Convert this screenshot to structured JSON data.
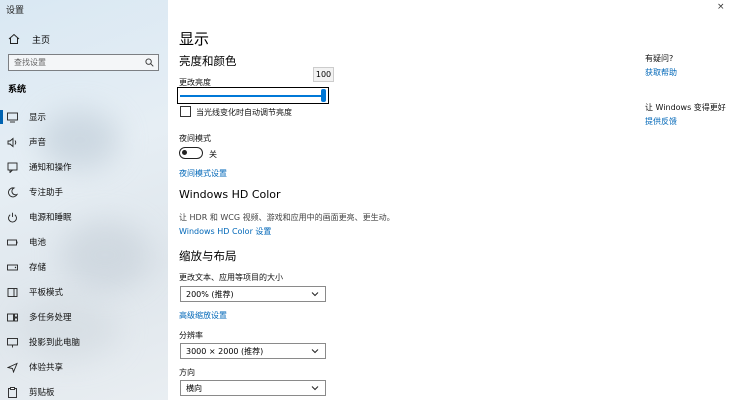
{
  "window": {
    "title": "设置",
    "close_glyph": "×"
  },
  "sidebar": {
    "home_label": "主页",
    "search_placeholder": "查找设置",
    "section": "系统",
    "items": [
      {
        "label": "显示",
        "icon": "monitor-icon"
      },
      {
        "label": "声音",
        "icon": "speaker-icon"
      },
      {
        "label": "通知和操作",
        "icon": "notification-icon"
      },
      {
        "label": "专注助手",
        "icon": "moon-icon"
      },
      {
        "label": "电源和睡眠",
        "icon": "power-icon"
      },
      {
        "label": "电池",
        "icon": "battery-icon"
      },
      {
        "label": "存储",
        "icon": "storage-icon"
      },
      {
        "label": "平板模式",
        "icon": "tablet-icon"
      },
      {
        "label": "多任务处理",
        "icon": "multitask-icon"
      },
      {
        "label": "投影到此电脑",
        "icon": "projector-icon"
      },
      {
        "label": "体验共享",
        "icon": "share-icon"
      },
      {
        "label": "剪贴板",
        "icon": "clipboard-icon"
      }
    ]
  },
  "main": {
    "title": "显示",
    "brightness": {
      "heading": "亮度和颜色",
      "label": "更改亮度",
      "value": 100,
      "tooltip": "100",
      "auto_checkbox_label": "当光线变化时自动调节亮度",
      "auto_checked": false
    },
    "night_light": {
      "label": "夜间模式",
      "toggle_state": "关",
      "toggle_on": false,
      "settings_link": "夜间模式设置"
    },
    "hdr": {
      "heading": "Windows HD Color",
      "description": "让 HDR 和 WCG 视频、游戏和应用中的画面更亮、更生动。",
      "settings_link": "Windows HD Color 设置"
    },
    "layout": {
      "heading": "缩放与布局",
      "scale_label": "更改文本、应用等项目的大小",
      "scale_value": "200% (推荐)",
      "advanced_link": "高级缩放设置",
      "resolution_label": "分辨率",
      "resolution_value": "3000 × 2000 (推荐)",
      "orientation_label": "方向",
      "orientation_value": "横向"
    }
  },
  "right_panel": {
    "question_title": "有疑问?",
    "help_link": "获取帮助",
    "improve_title": "让 Windows 变得更好",
    "feedback_link": "提供反馈"
  },
  "colors": {
    "accent": "#0078d7",
    "link": "#0067b8"
  }
}
